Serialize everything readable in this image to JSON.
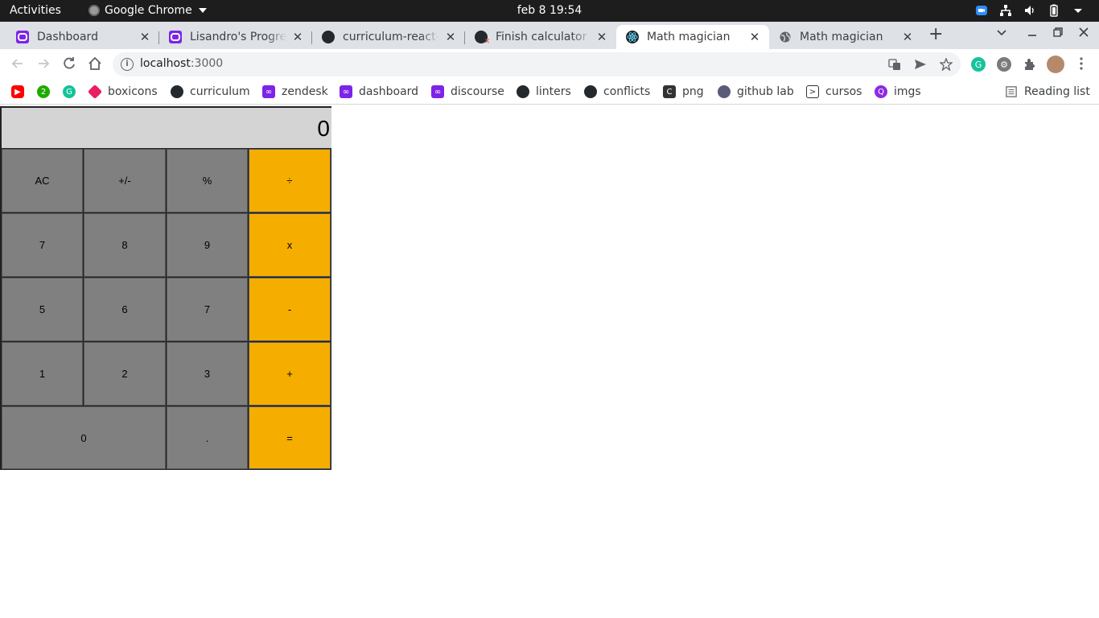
{
  "system_bar": {
    "activities": "Activities",
    "app_name": "Google Chrome",
    "clock": "feb 8  19:54"
  },
  "tabs": [
    {
      "title": "Dashboard",
      "icon": "microverse-icon"
    },
    {
      "title": "Lisandro's Progress",
      "icon": "microverse-icon"
    },
    {
      "title": "curriculum-react-redux",
      "icon": "github-icon"
    },
    {
      "title": "Finish calculator components",
      "icon": "github-pr-icon"
    },
    {
      "title": "Math magician",
      "icon": "react-icon",
      "active": true
    },
    {
      "title": "Math magician",
      "icon": "globe-icon"
    }
  ],
  "toolbar": {
    "url_host": "localhost",
    "url_port": ":3000"
  },
  "bookmarks": [
    {
      "label": "",
      "icon": "youtube-icon"
    },
    {
      "label": "",
      "icon": "badge-icon"
    },
    {
      "label": "",
      "icon": "grammarly-icon"
    },
    {
      "label": "boxicons",
      "icon": "boxicons-icon"
    },
    {
      "label": "curriculum",
      "icon": "github-icon"
    },
    {
      "label": "zendesk",
      "icon": "microverse-icon"
    },
    {
      "label": "dashboard",
      "icon": "microverse-icon"
    },
    {
      "label": "discourse",
      "icon": "microverse-icon"
    },
    {
      "label": "linters",
      "icon": "github-icon"
    },
    {
      "label": "conflicts",
      "icon": "github-icon"
    },
    {
      "label": "png",
      "icon": "c-icon"
    },
    {
      "label": "github lab",
      "icon": "octocat-icon"
    },
    {
      "label": "cursos",
      "icon": "terminal-icon"
    },
    {
      "label": "imgs",
      "icon": "q-icon"
    }
  ],
  "reading_list": "Reading list",
  "calculator": {
    "display": "0",
    "keys": {
      "ac": "AC",
      "sign": "+/-",
      "percent": "%",
      "divide": "÷",
      "seven": "7",
      "eight": "8",
      "nine": "9",
      "multiply": "x",
      "five": "5",
      "six": "6",
      "seven_b": "7",
      "minus": "-",
      "one": "1",
      "two": "2",
      "three": "3",
      "plus": "+",
      "zero": "0",
      "dot": ".",
      "equals": "="
    },
    "colors": {
      "digit": "#808080",
      "operator": "#f5ad00",
      "display": "#d4d4d4"
    }
  }
}
